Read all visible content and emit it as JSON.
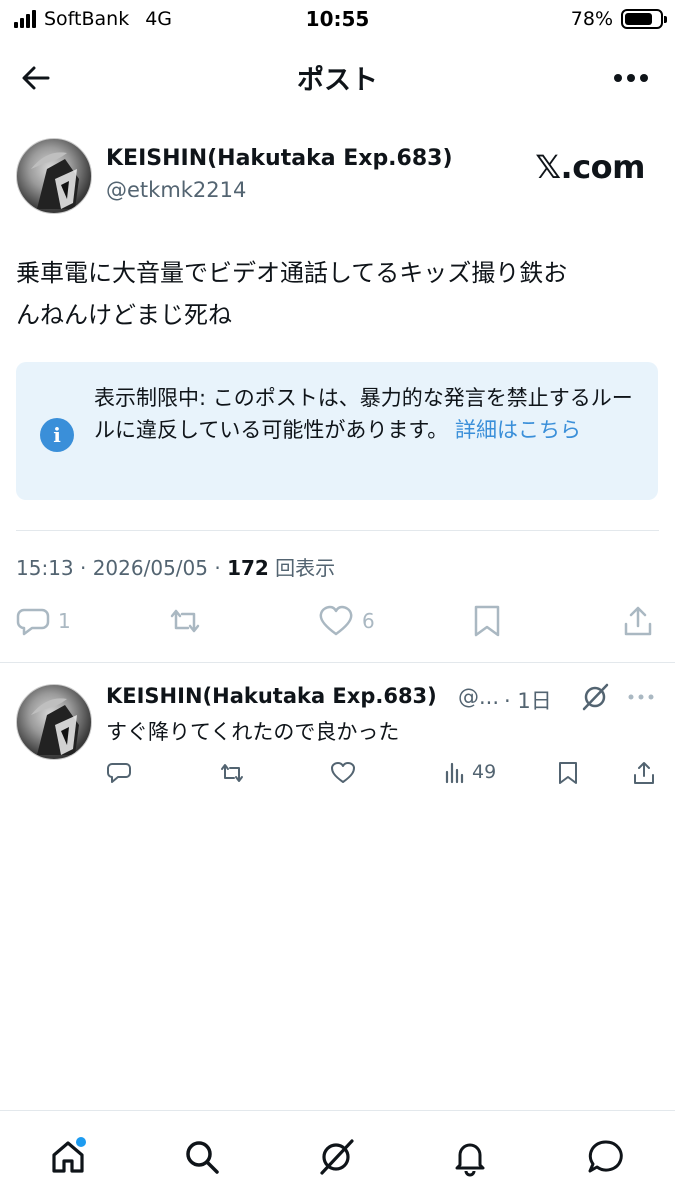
{
  "status_bar": {
    "carrier": "SoftBank",
    "network": "4G",
    "time": "10:55",
    "battery_text": "78%",
    "battery_level": 0.78
  },
  "header": {
    "title": "ポスト"
  },
  "post": {
    "author_name": "KEISHIN(Hakutaka Exp.683)",
    "author_handle": "@etkmk2214",
    "brand": "𝕏.com",
    "text_line1": "乗車電に大音量でビデオ通話してるキッズ撮り鉄お",
    "text_line2": "んねんけどまじ死ね",
    "notice": {
      "text": "表示制限中: このポストは、暴力的な発言を禁止するルールに違反している可能性があります。",
      "link": "詳細はこちら"
    },
    "timestamp": "15:13 · 2026/05/05 · ",
    "views_count": "172",
    "views_label": " 回表示",
    "actions": {
      "reply_count": "1",
      "like_count": "6"
    }
  },
  "reply": {
    "author_name": "KEISHIN(Hakutaka Exp.683)",
    "handle": "@...",
    "time": "· 1日",
    "text": "すぐ降りてくれたので良かった",
    "views": "49"
  },
  "colors": {
    "accent": "#1d9bf0",
    "notice_bg": "#e8f3fb",
    "info_icon": "#3a8fd9",
    "muted": "#536471"
  },
  "tabs": [
    "home-icon",
    "search-icon",
    "grok-icon",
    "notifications-icon",
    "messages-icon"
  ]
}
